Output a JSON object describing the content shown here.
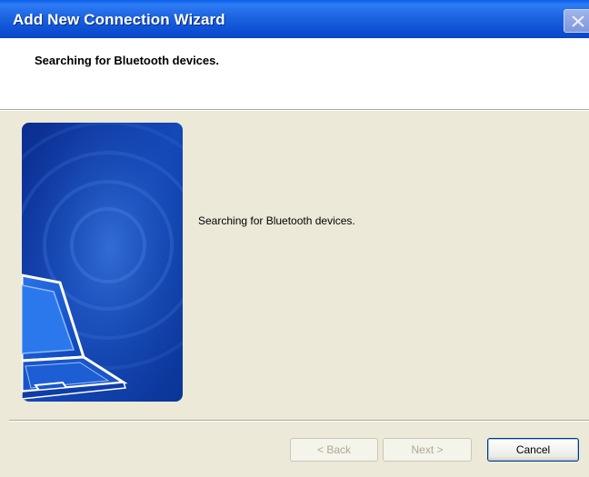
{
  "window": {
    "title": "Add New Connection Wizard",
    "close_icon": "close-icon",
    "titlebar_color": "#0a5fe8"
  },
  "header": {
    "title": "Searching for Bluetooth devices."
  },
  "main": {
    "status_text": "Searching for Bluetooth devices.",
    "illustration": "laptop-illustration"
  },
  "buttons": {
    "back_label": "< Back",
    "next_label": "Next >",
    "cancel_label": "Cancel",
    "back_enabled": false,
    "next_enabled": false
  }
}
